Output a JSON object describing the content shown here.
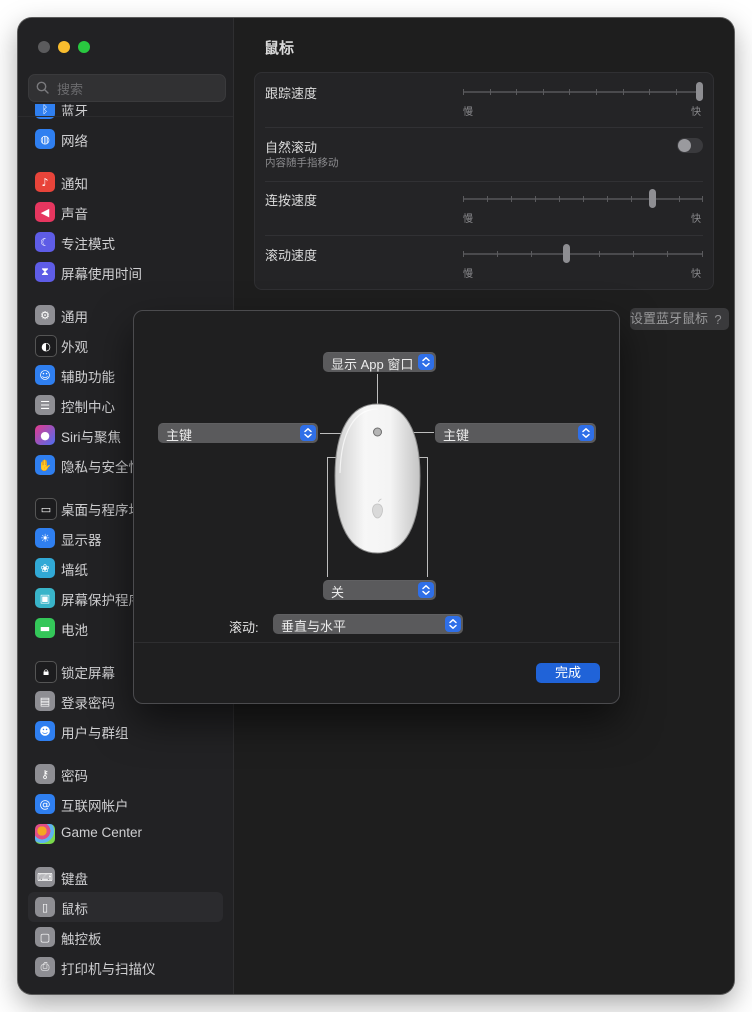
{
  "window": {
    "sidebar": {
      "search_placeholder": "搜索",
      "partial_item_label": "蓝牙",
      "items": [
        {
          "label": "网络",
          "icon": "globe-icon",
          "color": "#2f7ff0"
        },
        {
          "label": "通知",
          "icon": "bell-icon",
          "color": "#e8443a"
        },
        {
          "label": "声音",
          "icon": "speaker-icon",
          "color": "#e6365f"
        },
        {
          "label": "专注模式",
          "icon": "moon-icon",
          "color": "#5e5ce6"
        },
        {
          "label": "屏幕使用时间",
          "icon": "hourglass-icon",
          "color": "#5e5ce6"
        },
        {
          "label": "通用",
          "icon": "gear-icon",
          "color": "#8e8e93"
        },
        {
          "label": "外观",
          "icon": "appearance-icon",
          "color": "#1c1c1e"
        },
        {
          "label": "辅助功能",
          "icon": "accessibility-icon",
          "color": "#2f7ff0"
        },
        {
          "label": "控制中心",
          "icon": "control-center-icon",
          "color": "#8e8e93"
        },
        {
          "label": "Siri与聚焦",
          "icon": "siri-icon",
          "color": "#7b3fe4"
        },
        {
          "label": "隐私与安全性",
          "icon": "hand-icon",
          "color": "#2f7ff0"
        },
        {
          "label": "桌面与程序坞",
          "icon": "dock-icon",
          "color": "#1c1c1e"
        },
        {
          "label": "显示器",
          "icon": "sun-icon",
          "color": "#2f7ff0"
        },
        {
          "label": "墙纸",
          "icon": "flower-icon",
          "color": "#31a9d6"
        },
        {
          "label": "屏幕保护程序",
          "icon": "screensaver-icon",
          "color": "#39b4c9"
        },
        {
          "label": "电池",
          "icon": "battery-icon",
          "color": "#34c759"
        },
        {
          "label": "锁定屏幕",
          "icon": "lock-screen-icon",
          "color": "#1c1c1e"
        },
        {
          "label": "登录密码",
          "icon": "lock-icon",
          "color": "#8e8e93"
        },
        {
          "label": "用户与群组",
          "icon": "users-icon",
          "color": "#2f7ff0"
        },
        {
          "label": "密码",
          "icon": "key-icon",
          "color": "#8e8e93"
        },
        {
          "label": "互联网帐户",
          "icon": "at-icon",
          "color": "#2f7ff0"
        },
        {
          "label": "Game Center",
          "icon": "game-center-icon",
          "color": "#e0e0e0"
        },
        {
          "label": "键盘",
          "icon": "keyboard-icon",
          "color": "#8e8e93"
        },
        {
          "label": "鼠标",
          "icon": "mouse-icon",
          "color": "#8e8e93"
        },
        {
          "label": "触控板",
          "icon": "trackpad-icon",
          "color": "#8e8e93"
        },
        {
          "label": "打印机与扫描仪",
          "icon": "printer-icon",
          "color": "#8e8e93"
        }
      ]
    },
    "main": {
      "title": "鼠标",
      "tracking_speed": {
        "label": "跟踪速度",
        "min": "慢",
        "max": "快",
        "value": 1.0
      },
      "natural_scrolling": {
        "label": "自然滚动",
        "sub": "内容随手指移动",
        "on": false
      },
      "double_click_speed": {
        "label": "连按速度",
        "min": "慢",
        "max": "快",
        "value": 0.8
      },
      "scroll_speed": {
        "label": "滚动速度",
        "min": "慢",
        "max": "快",
        "value": 0.45
      },
      "bluetooth_button": "设置蓝牙鼠标…",
      "help": "?"
    }
  },
  "dialog": {
    "top_popup": "显示 App 窗口",
    "left_popup": "主键",
    "right_popup": "主键",
    "bottom_popup": "关",
    "scroll_label": "滚动:",
    "scroll_popup": "垂直与水平",
    "done_button": "完成",
    "accent_color": "#2f6fe8"
  }
}
